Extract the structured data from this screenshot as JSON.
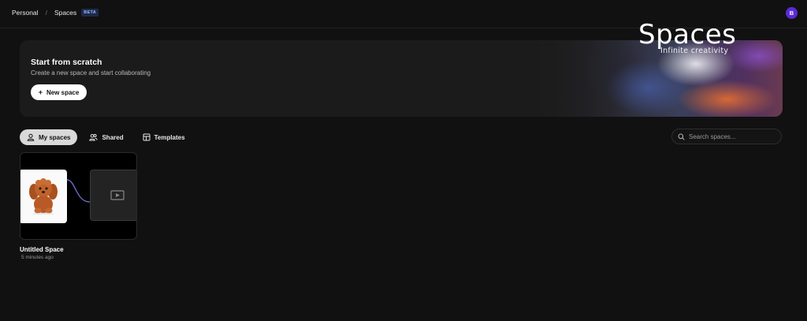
{
  "breadcrumb": {
    "root": "Personal",
    "separator": "/",
    "current": "Spaces",
    "badge": "BETA"
  },
  "user": {
    "avatar_initial": "B",
    "avatar_color": "#5b2bd6"
  },
  "hero": {
    "title": "Start from scratch",
    "subtitle": "Create a new space and start collaborating",
    "button_label": "New space",
    "brand": "Spaces",
    "tagline": "Infinite creativity"
  },
  "tabs": [
    {
      "label": "My spaces",
      "icon": "user-icon",
      "active": true
    },
    {
      "label": "Shared",
      "icon": "users-icon",
      "active": false
    },
    {
      "label": "Templates",
      "icon": "layout-icon",
      "active": false
    }
  ],
  "search": {
    "placeholder": "Search spaces..."
  },
  "spaces": [
    {
      "title": "Untitled Space",
      "updated": "5 minutes ago"
    }
  ]
}
